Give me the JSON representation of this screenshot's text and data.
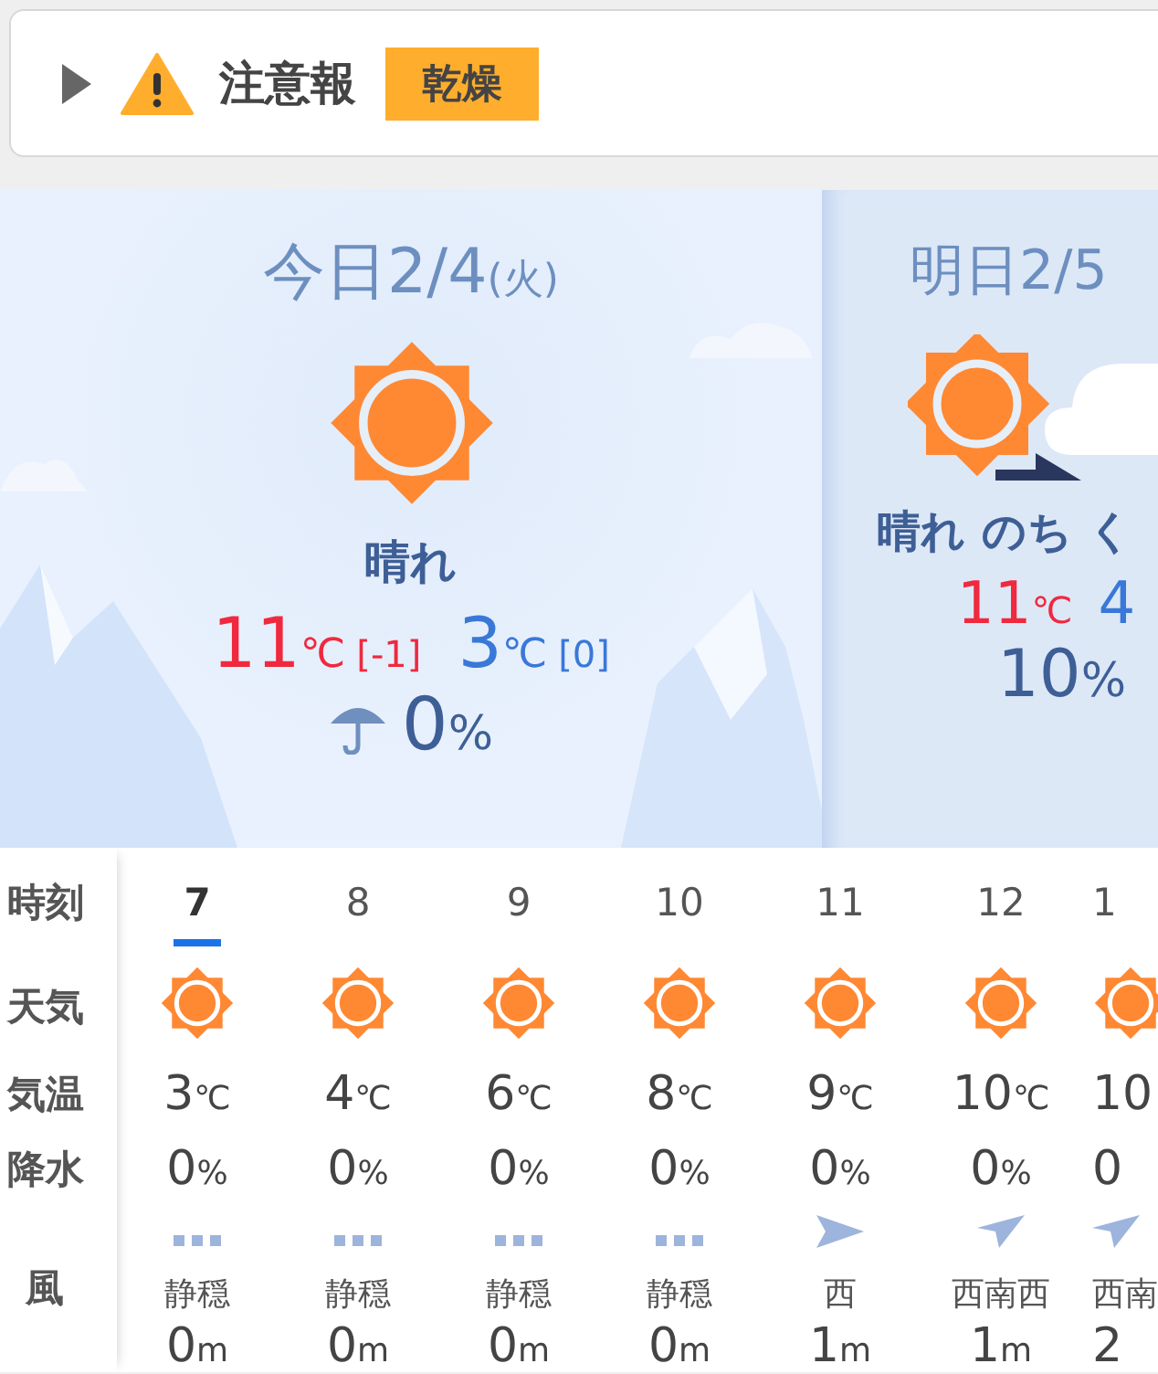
{
  "advisory": {
    "expanded": false,
    "title": "注意報",
    "tags": [
      "乾燥"
    ]
  },
  "days": [
    {
      "kind": "full",
      "title": "今日2/4",
      "weekday": "(火)",
      "weather_icon": {
        "kind": "sunny"
      },
      "weather": "晴れ",
      "high": "11",
      "high_unit": "℃",
      "high_diff": "[-1]",
      "low": "3",
      "low_unit": "℃",
      "low_diff": "[0]",
      "precip": "0",
      "precip_unit": "%"
    },
    {
      "kind": "partial",
      "title": "明日2/5",
      "weather_icon": {
        "kind": "sunny-then-cloudy"
      },
      "weather": "晴れ のち く",
      "high": "11",
      "high_unit": "℃",
      "low": "4",
      "precip": "10",
      "precip_unit": "%"
    }
  ],
  "hourly": {
    "labels": [
      "時刻",
      "天気",
      "気温",
      "降水",
      "風"
    ],
    "columns": [
      {
        "kind": "full",
        "hour": "7",
        "selected": true,
        "weather_icon": {
          "kind": "sunny"
        },
        "temp": "3",
        "temp_unit": "℃",
        "precip": "0",
        "precip_unit": "%",
        "wind_icon": {
          "kind": "calm"
        },
        "wind_dir": "静穏",
        "wind_speed": "0",
        "wind_unit": "m"
      },
      {
        "kind": "full",
        "hour": "8",
        "selected": false,
        "weather_icon": {
          "kind": "sunny"
        },
        "temp": "4",
        "temp_unit": "℃",
        "precip": "0",
        "precip_unit": "%",
        "wind_icon": {
          "kind": "calm"
        },
        "wind_dir": "静穏",
        "wind_speed": "0",
        "wind_unit": "m"
      },
      {
        "kind": "full",
        "hour": "9",
        "selected": false,
        "weather_icon": {
          "kind": "sunny"
        },
        "temp": "6",
        "temp_unit": "℃",
        "precip": "0",
        "precip_unit": "%",
        "wind_icon": {
          "kind": "calm"
        },
        "wind_dir": "静穏",
        "wind_speed": "0",
        "wind_unit": "m"
      },
      {
        "kind": "full",
        "hour": "10",
        "selected": false,
        "weather_icon": {
          "kind": "sunny"
        },
        "temp": "8",
        "temp_unit": "℃",
        "precip": "0",
        "precip_unit": "%",
        "wind_icon": {
          "kind": "calm"
        },
        "wind_dir": "静穏",
        "wind_speed": "0",
        "wind_unit": "m"
      },
      {
        "kind": "full",
        "hour": "11",
        "selected": false,
        "weather_icon": {
          "kind": "sunny"
        },
        "temp": "9",
        "temp_unit": "℃",
        "precip": "0",
        "precip_unit": "%",
        "wind_icon": {
          "kind": "arrow-right"
        },
        "wind_dir": "西",
        "wind_speed": "1",
        "wind_unit": "m"
      },
      {
        "kind": "full",
        "hour": "12",
        "selected": false,
        "weather_icon": {
          "kind": "sunny"
        },
        "temp": "10",
        "temp_unit": "℃",
        "precip": "0",
        "precip_unit": "%",
        "wind_icon": {
          "kind": "arrow-up-right"
        },
        "wind_dir": "西南西",
        "wind_speed": "1",
        "wind_unit": "m"
      },
      {
        "kind": "cut",
        "hour": "1",
        "selected": false,
        "weather_icon": {
          "kind": "sunny"
        },
        "temp": "10",
        "precip": "0",
        "wind_icon": {
          "kind": "arrow-up-right"
        },
        "wind_dir": "西南",
        "wind_speed": "2"
      }
    ]
  }
}
